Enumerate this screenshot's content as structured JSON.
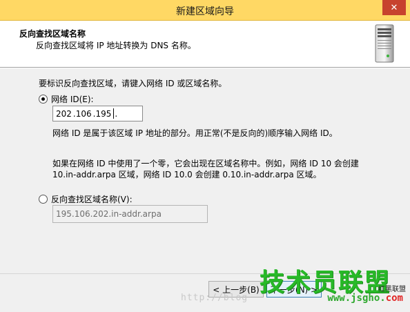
{
  "window": {
    "title": "新建区域向导",
    "close_label": "✕"
  },
  "header": {
    "title": "反向查找区域名称",
    "subtitle": "反向查找区域将 IP 地址转换为 DNS 名称。",
    "icon": "server-icon"
  },
  "main": {
    "instruction": "要标识反向查找区域，请键入网络 ID 或区域名称。",
    "network_id_option": {
      "label": "网络 ID(E):",
      "selected": true
    },
    "ip_octets": [
      "202",
      ".106",
      ".195",
      "."
    ],
    "network_id_description": "网络 ID 是属于该区域 IP 地址的部分。用正常(不是反向的)顺序输入网络 ID。",
    "zero_note_line1": "如果在网络 ID 中使用了一个零，它会出现在区域名称中。例如，网络 ID 10 会创建",
    "zero_note_line2": "10.in-addr.arpa 区域，网络 ID 10.0 会创建 0.10.in-addr.arpa 区域。",
    "zone_name_option": {
      "label": "反向查找区域名称(V):",
      "selected": false
    },
    "zone_name_value": "195.106.202.in-addr.arpa"
  },
  "buttons": {
    "back": "< 上一步(B)",
    "next": "下一步(N) >"
  },
  "watermark": {
    "brand": "技术员联盟",
    "url_main": "www.jsgho.",
    "url_tld": "com",
    "side": "红黑联盟",
    "blog": "http://blog"
  },
  "colors": {
    "titlebar": "#ffd864",
    "close": "#c7422e",
    "content_bg": "#f0f0f0",
    "watermark_green": "#28b928",
    "watermark_red": "#e12525"
  }
}
